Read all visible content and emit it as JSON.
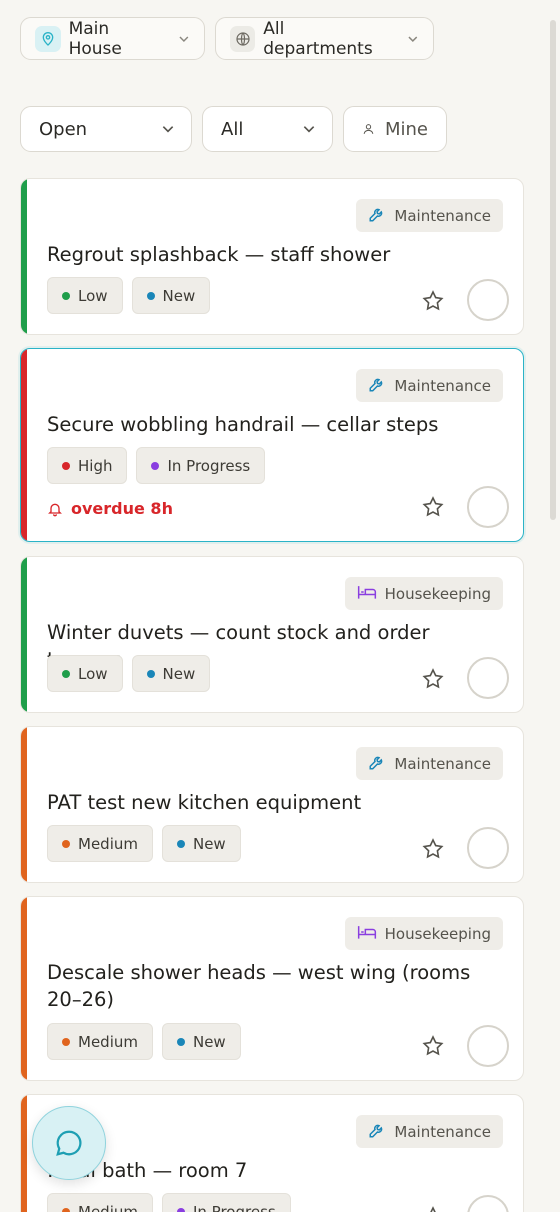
{
  "header": {
    "location": "Main House",
    "department": "All departments"
  },
  "filters": {
    "status": "Open",
    "scope": "All",
    "mine": "Mine"
  },
  "tasks": [
    {
      "title": "Regrout splashback — staff shower",
      "department": "Maintenance",
      "dept_icon": "wrench-icon",
      "priority": "Low",
      "priority_color": "#1f9e4a",
      "status": "New",
      "status_color": "#1a86b8",
      "bar_color": "#1f9e4a",
      "active": false,
      "overdue": ""
    },
    {
      "title": "Secure wobbling handrail — cellar steps",
      "department": "Maintenance",
      "dept_icon": "wrench-icon",
      "priority": "High",
      "priority_color": "#d8262a",
      "status": "In Progress",
      "status_color": "#8a3ee0",
      "bar_color": "#d8262a",
      "active": true,
      "overdue": "overdue 8h"
    },
    {
      "title": "Winter duvets — count stock and order toppers",
      "department": "Housekeeping",
      "dept_icon": "bed-icon",
      "priority": "Low",
      "priority_color": "#1f9e4a",
      "status": "New",
      "status_color": "#1a86b8",
      "bar_color": "#1f9e4a",
      "active": false,
      "overdue": ""
    },
    {
      "title": "PAT test new kitchen equipment",
      "department": "Maintenance",
      "dept_icon": "wrench-icon",
      "priority": "Medium",
      "priority_color": "#e0641e",
      "status": "New",
      "status_color": "#1a86b8",
      "bar_color": "#e0641e",
      "active": false,
      "overdue": ""
    },
    {
      "title": "Descale shower heads — west wing (rooms 20–26)",
      "department": "Housekeeping",
      "dept_icon": "bed-icon",
      "priority": "Medium",
      "priority_color": "#e0641e",
      "status": "New",
      "status_color": "#1a86b8",
      "bar_color": "#e0641e",
      "active": false,
      "overdue": ""
    },
    {
      "title": "…eal bath — room 7",
      "department": "Maintenance",
      "dept_icon": "wrench-icon",
      "priority": "Medium",
      "priority_color": "#e0641e",
      "status": "In Progress",
      "status_color": "#8a3ee0",
      "bar_color": "#e0641e",
      "active": false,
      "overdue": ""
    }
  ],
  "colors": {
    "accent": "#2bb3c7",
    "housekeeping": "#8a3ee0",
    "maintenance": "#1a86b8"
  }
}
